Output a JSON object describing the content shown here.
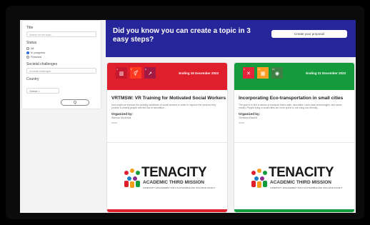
{
  "filters": {
    "title_label": "Title",
    "title_placeholder": "Search for the topic...",
    "status_label": "Status",
    "status_options": [
      "All",
      "In progress",
      "Finished"
    ],
    "status_selected": 1,
    "challenges_label": "Societal challenges",
    "challenges_placeholder": "Societal challenges",
    "country_label": "Country",
    "country_value": "Greece",
    "search_label": "Q"
  },
  "banner": {
    "text": "Did you know you can create a topic in 3 easy steps?",
    "button_label": "Create your proposal",
    "color": "#26259a"
  },
  "cards": [
    {
      "date": "Ending 16 December 2023",
      "title": "VRTMSW: VR Training for Motivated Social Workers",
      "description": "How might we improve the working conditions of social workers in order to improve the services they provide to elderly people with the use of simulation...",
      "organized_by_label": "Organized by:",
      "organizer": "Stavros Mourmos",
      "more": "more",
      "logo_name": "TENACITY",
      "logo_subtitle": "ACADEMIC THIRD MISSION",
      "logo_tagline": "COMMUNITY ENGAGEMENT FOR A SUSTAINABLE AND INCLUSIVE SOCIETY",
      "accent": "#e01f2d",
      "sdg_tiles": [
        {
          "num": "4",
          "label": "QUALITY EDUCATION",
          "color": "#c5192d",
          "icon": "book-icon"
        },
        {
          "num": "5",
          "label": "GENDER EQUALITY",
          "color": "#ff3a21",
          "icon": "equality-icon"
        },
        {
          "num": "8",
          "label": "DECENT WORK",
          "color": "#a21942",
          "icon": "growth-icon"
        }
      ]
    },
    {
      "date": "Ending 31 December 2023",
      "title": "Incorporating Eco-transportation in small cities",
      "description": "The goal is to find a means of transport that is safe, innovative, uses clean technologies, and saves money. People living in small cities are more prone to not using eco-friendly...",
      "organized_by_label": "Organized by:",
      "organizer": "Christina Mavridi",
      "more": "more",
      "logo_name": "TENACITY",
      "logo_subtitle": "ACADEMIC THIRD MISSION",
      "logo_tagline": "COMMUNITY ENGAGEMENT FOR A SUSTAINABLE AND INCLUSIVE SOCIETY",
      "accent": "#139b3c",
      "sdg_tiles": [
        {
          "num": "3",
          "label": "GOOD HEALTH",
          "color": "#e5243b",
          "icon": "heart-icon"
        },
        {
          "num": "11",
          "label": "SUSTAINABLE CITIES",
          "color": "#fd9d24",
          "icon": "city-icon"
        },
        {
          "num": "13",
          "label": "CLIMATE ACTION",
          "color": "#3f7e44",
          "icon": "eye-icon"
        }
      ]
    }
  ]
}
